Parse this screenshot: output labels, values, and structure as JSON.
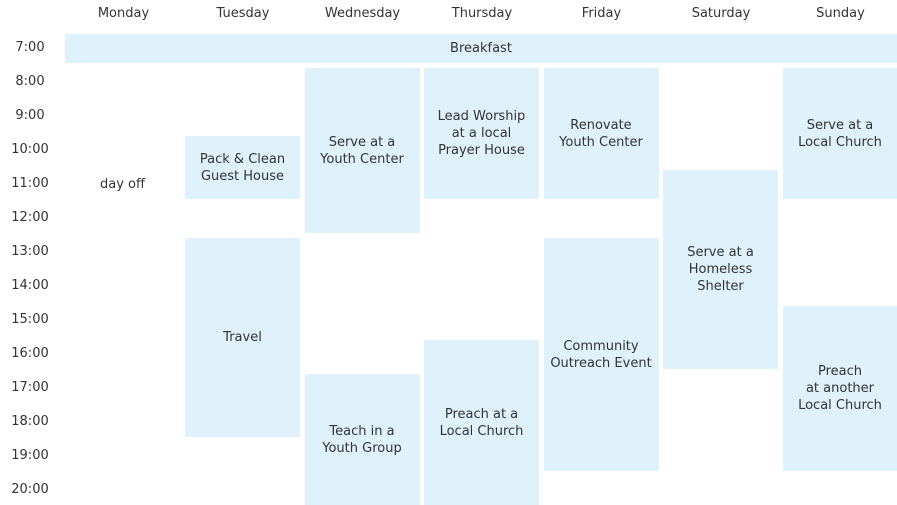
{
  "days": [
    "Monday",
    "Tuesday",
    "Wednesday",
    "Thursday",
    "Friday",
    "Saturday",
    "Sunday"
  ],
  "times": [
    "7:00",
    "8:00",
    "9:00",
    "10:00",
    "11:00",
    "12:00",
    "13:00",
    "14:00",
    "15:00",
    "16:00",
    "17:00",
    "18:00",
    "19:00",
    "20:00"
  ],
  "breakfast": "Breakfast",
  "monday_note": "day off",
  "event_color": "#dff1fa",
  "events": [
    {
      "day": "Tuesday",
      "start": 10,
      "end": 12,
      "title": "Pack & Clean\nGuest House"
    },
    {
      "day": "Tuesday",
      "start": 13,
      "end": 19,
      "title": "Travel"
    },
    {
      "day": "Wednesday",
      "start": 8,
      "end": 13,
      "title": "Serve at a\nYouth Center"
    },
    {
      "day": "Wednesday",
      "start": 17,
      "end": 21,
      "title": "Teach in a\nYouth Group"
    },
    {
      "day": "Thursday",
      "start": 8,
      "end": 12,
      "title": "Lead Worship\nat a local\nPrayer House"
    },
    {
      "day": "Thursday",
      "start": 16,
      "end": 21,
      "title": "Preach at a\nLocal Church"
    },
    {
      "day": "Friday",
      "start": 8,
      "end": 12,
      "title": "Renovate\nYouth Center"
    },
    {
      "day": "Friday",
      "start": 13,
      "end": 20,
      "title": "Community\nOutreach Event"
    },
    {
      "day": "Saturday",
      "start": 11,
      "end": 17,
      "title": "Serve at a\nHomeless\nShelter"
    },
    {
      "day": "Sunday",
      "start": 8,
      "end": 12,
      "title": "Serve at a\nLocal Church"
    },
    {
      "day": "Sunday",
      "start": 15,
      "end": 20,
      "title": "Preach\nat another\nLocal Church"
    }
  ]
}
